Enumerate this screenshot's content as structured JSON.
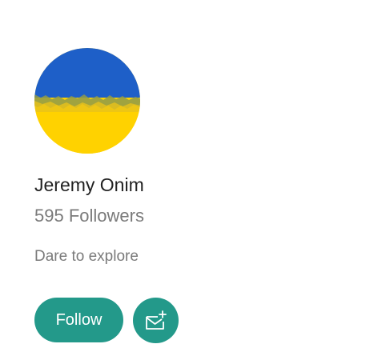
{
  "profile": {
    "name": "Jeremy Onim",
    "followers": "595 Followers",
    "bio": "Dare to explore",
    "avatar_colors": {
      "top": "#1e5fc8",
      "bottom": "#ffd200"
    }
  },
  "actions": {
    "follow_label": "Follow",
    "message_icon": "mail-plus-icon"
  },
  "colors": {
    "accent": "#23998a"
  }
}
